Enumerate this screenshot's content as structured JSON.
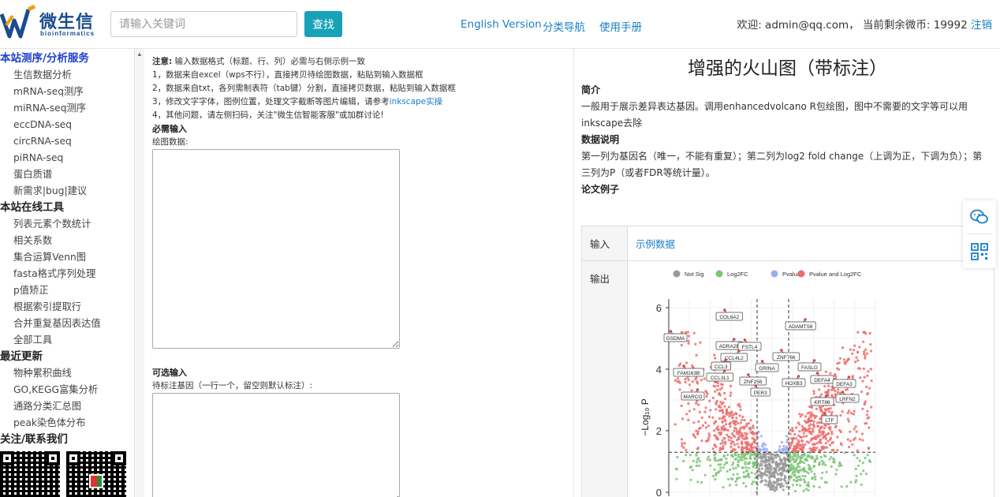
{
  "header": {
    "logo_text": "微生信",
    "logo_sub": "bioinformatics",
    "search_placeholder": "请输入关键词",
    "search_button": "查找",
    "nav": [
      "English Version",
      "分类导航",
      "使用手册"
    ],
    "welcome_text": "欢迎: admin@qq.com， 当前剩余微币: 19992",
    "logout": "注销"
  },
  "sidebar": {
    "sections": [
      {
        "title": "本站测序/分析服务",
        "items": [
          "生信数据分析",
          "mRNA-seq测序",
          "miRNA-seq测序",
          "eccDNA-seq",
          "circRNA-seq",
          "piRNA-seq",
          "蛋白质谱",
          "新需求|bug|建议"
        ]
      },
      {
        "title": "本站在线工具",
        "items": [
          "列表元素个数统计",
          "相关系数",
          "集合运算Venn图",
          "fasta格式序列处理",
          "p值矫正",
          "根据索引提取行",
          "合并重复基因表达值",
          "全部工具"
        ]
      },
      {
        "title": "最近更新",
        "items": [
          "物种累积曲线",
          "GO,KEGG富集分析",
          "通路分类汇总图",
          "peak染色体分布"
        ]
      },
      {
        "title": "关注/联系我们",
        "items": []
      }
    ]
  },
  "input_panel": {
    "note_label": "注意:",
    "note_text": " 输入数据格式（标题、行、列）必需与右侧示例一致",
    "notes": [
      "1，数据来自excel（wps不行），直接拷贝待绘图数据，粘贴到输入数据框",
      "2，数据来自txt，各列需制表符（tab键）分割，直接拷贝数据，粘贴到输入数据框",
      "3，修改文字字体，图例位置，处理文字截断等图片编辑，请参考",
      "4，其他问题，请左侧扫码，关注\"微生信智能客服\"或加群讨论!"
    ],
    "inkscape_link": "inkscape实操",
    "required_label": "必需输入",
    "plot_data_label": "绘图数据:",
    "optional_label": "可选输入",
    "genes_label": "待标注基因（一行一个，留空则默认标注）:"
  },
  "description": {
    "title": "增强的火山图（带标注）",
    "intro_heading": "简介",
    "intro_text": "一般用于展示差异表达基因。调用enhancedvolcano R包绘图，图中不需要的文字等可以用inkscape去除",
    "data_heading": "数据说明",
    "data_text": "第一列为基因名（唯一，不能有重复）；第二列为log2 fold change（上调为正，下调为负）；第三列为P（或者FDR等统计量）。",
    "paper_heading": "论文例子",
    "input_key": "输入",
    "input_link": "示例数据",
    "output_key": "输出"
  },
  "chart_data": {
    "type": "scatter",
    "legend": [
      "Not Sig",
      "Log2FC",
      "Pvalue",
      "Pvalue and Log2FC"
    ],
    "legend_colors": [
      "#999999",
      "#7cc475",
      "#9aaef0",
      "#f06b6b"
    ],
    "ylabel": "−Log₁₀ P",
    "yticks": [
      0,
      2,
      4,
      6
    ],
    "labels": [
      "COL6A2",
      "ADAMTS6",
      "GSDMA",
      "ADRA2B",
      "FSTL4",
      "CCL4L2",
      "ZNF766",
      "CCL3",
      "GRINA",
      "FASLG",
      "FAM163B",
      "CCL3L1",
      "ZNF256",
      "HOXB3",
      "DEFA4",
      "DEFA3",
      "PER3",
      "MARCO",
      "LRFN2",
      "KRT86",
      "LTF"
    ]
  },
  "float_buttons": [
    "wechat-icon",
    "qrcode-icon"
  ]
}
